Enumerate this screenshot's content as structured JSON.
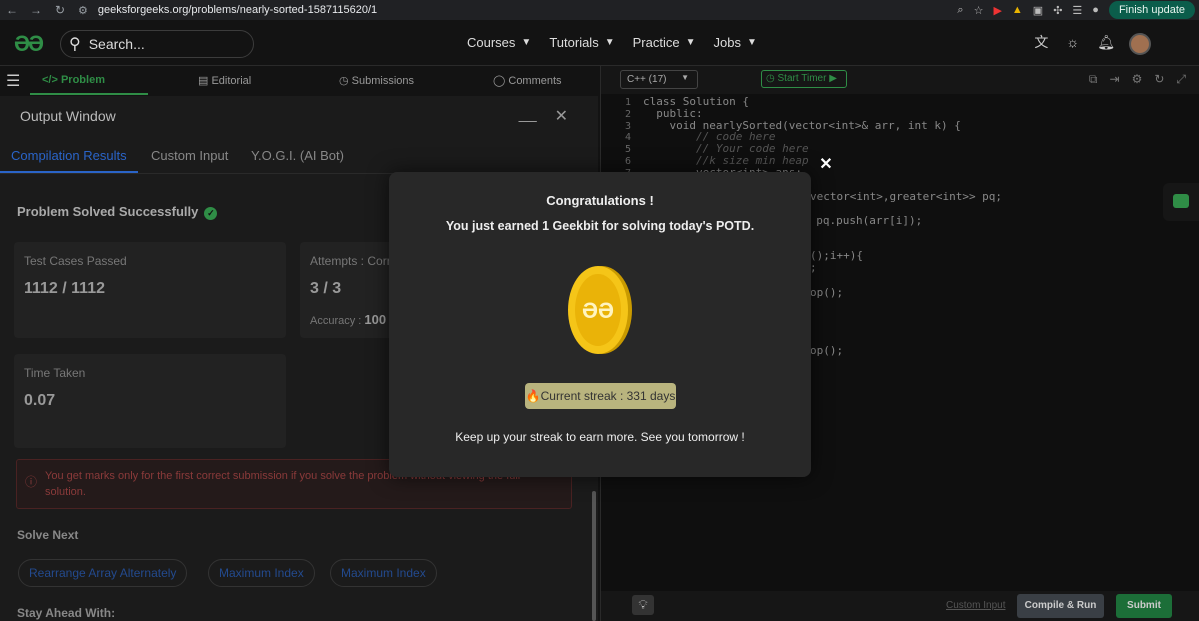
{
  "browser": {
    "back": "←",
    "forward": "→",
    "reload": "↻",
    "url": "geeksforgeeks.org/problems/nearly-sorted-1587115620/1",
    "finish_update": "Finish update"
  },
  "header": {
    "logo": "ƏƏ",
    "search_placeholder": "Search...",
    "nav": [
      "Courses",
      "Tutorials",
      "Practice",
      "Jobs"
    ]
  },
  "tabs": {
    "problem": "</> Problem",
    "editorial": "Editorial",
    "submissions": "Submissions",
    "comments": "Comments"
  },
  "output": {
    "title": "Output Window",
    "minimize": "__",
    "close": "✕",
    "sub_tabs": [
      "Compilation Results",
      "Custom Input",
      "Y.O.G.I. (AI Bot)"
    ],
    "solved": "Problem Solved Successfully",
    "test_cases_label": "Test Cases Passed",
    "test_cases_value": "1112 / 1112",
    "attempts_label": "Attempts : Corr",
    "attempts_value": "3 / 3",
    "accuracy_label": "Accuracy :",
    "accuracy_value": "100",
    "time_label": "Time Taken",
    "time_value": "0.07",
    "notice": "You get marks only for the first correct submission if you solve the problem without viewing the full solution.",
    "solve_next": "Solve Next",
    "suggestions": [
      "Rearrange Array Alternately",
      "Maximum Index",
      "Maximum Index"
    ],
    "stay_ahead": "Stay Ahead With:"
  },
  "editor": {
    "language": "C++ (17)",
    "start_timer": "Start Timer",
    "lines": [
      {
        "n": "1",
        "code": "class Solution {"
      },
      {
        "n": "2",
        "code": "  public:"
      },
      {
        "n": "3",
        "code": "    void nearlySorted(vector<int>& arr, int k) {"
      },
      {
        "n": "4",
        "code": "        // code here"
      },
      {
        "n": "5",
        "code": "        // Your code here"
      },
      {
        "n": "6",
        "code": "        //k size min heap"
      },
      {
        "n": "7",
        "code": "        vector<int> ans;"
      }
    ],
    "fragments": [
      "vector<int>,greater<int>> pq;",
      ") pq.push(arr[i]);",
      "();i++){",
      ";",
      "op();",
      "op();"
    ],
    "custom_input": "Custom Input",
    "compile_run": "Compile & Run",
    "submit": "Submit"
  },
  "modal": {
    "title": "Congratulations !",
    "subtitle": "You just earned 1 Geekbit for solving today's POTD.",
    "coin_icon": "geekbit-coin-icon",
    "streak": "🔥Current streak : 331 days",
    "footer": "Keep up your streak to earn more. See you tomorrow !",
    "close": "✕"
  },
  "colors": {
    "brand_green": "#2f8d46",
    "link_blue": "#2a64c8",
    "coin_gold": "#f5c518",
    "streak_bg": "#b9b47e"
  }
}
